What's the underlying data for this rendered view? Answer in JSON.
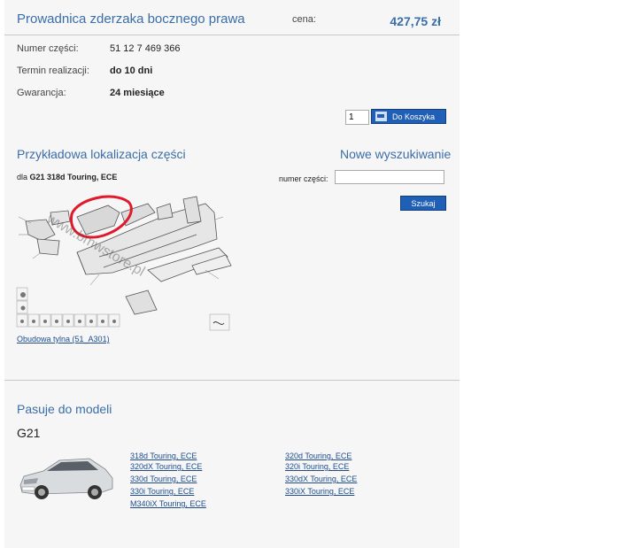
{
  "product": {
    "title": "Prowadnica zderzaka bocznego prawa",
    "price_label": "cena:",
    "price": "427,75 zł"
  },
  "details": [
    {
      "label": "Numer części:",
      "value": "51 12 7 469 366"
    },
    {
      "label": "Termin realizacji:",
      "value": "do 10 dni"
    },
    {
      "label": "Gwarancja:",
      "value": "24 miesiące"
    }
  ],
  "cart": {
    "quantity": "1",
    "add_label": "Do Koszyka",
    "accent_color": "#1f5fb5"
  },
  "location": {
    "title": "Przykładowa lokalizacja części",
    "for_prefix": "dla",
    "model": "G21 318d Touring, ECE",
    "part_link": "Obudowa tylna (51_A301)",
    "watermark": "www.bmwstore.pl"
  },
  "search": {
    "title": "Nowe wyszukiwanie",
    "label": "numer części:",
    "value": "",
    "button_label": "Szukaj"
  },
  "fits": {
    "title": "Pasuje do modeli",
    "series": "G21",
    "models_col1": [
      "318d Touring, ECE",
      "320dX Touring, ECE",
      "330d Touring, ECE",
      "330i Touring, ECE",
      "M340iX Touring, ECE"
    ],
    "models_col2": [
      "320d Touring, ECE",
      "320i Touring, ECE",
      "330dX Touring, ECE",
      "330iX Touring, ECE"
    ]
  },
  "colors": {
    "link": "#1f4d8c",
    "heading": "#3a6ea8",
    "highlight": "#e0192b"
  }
}
